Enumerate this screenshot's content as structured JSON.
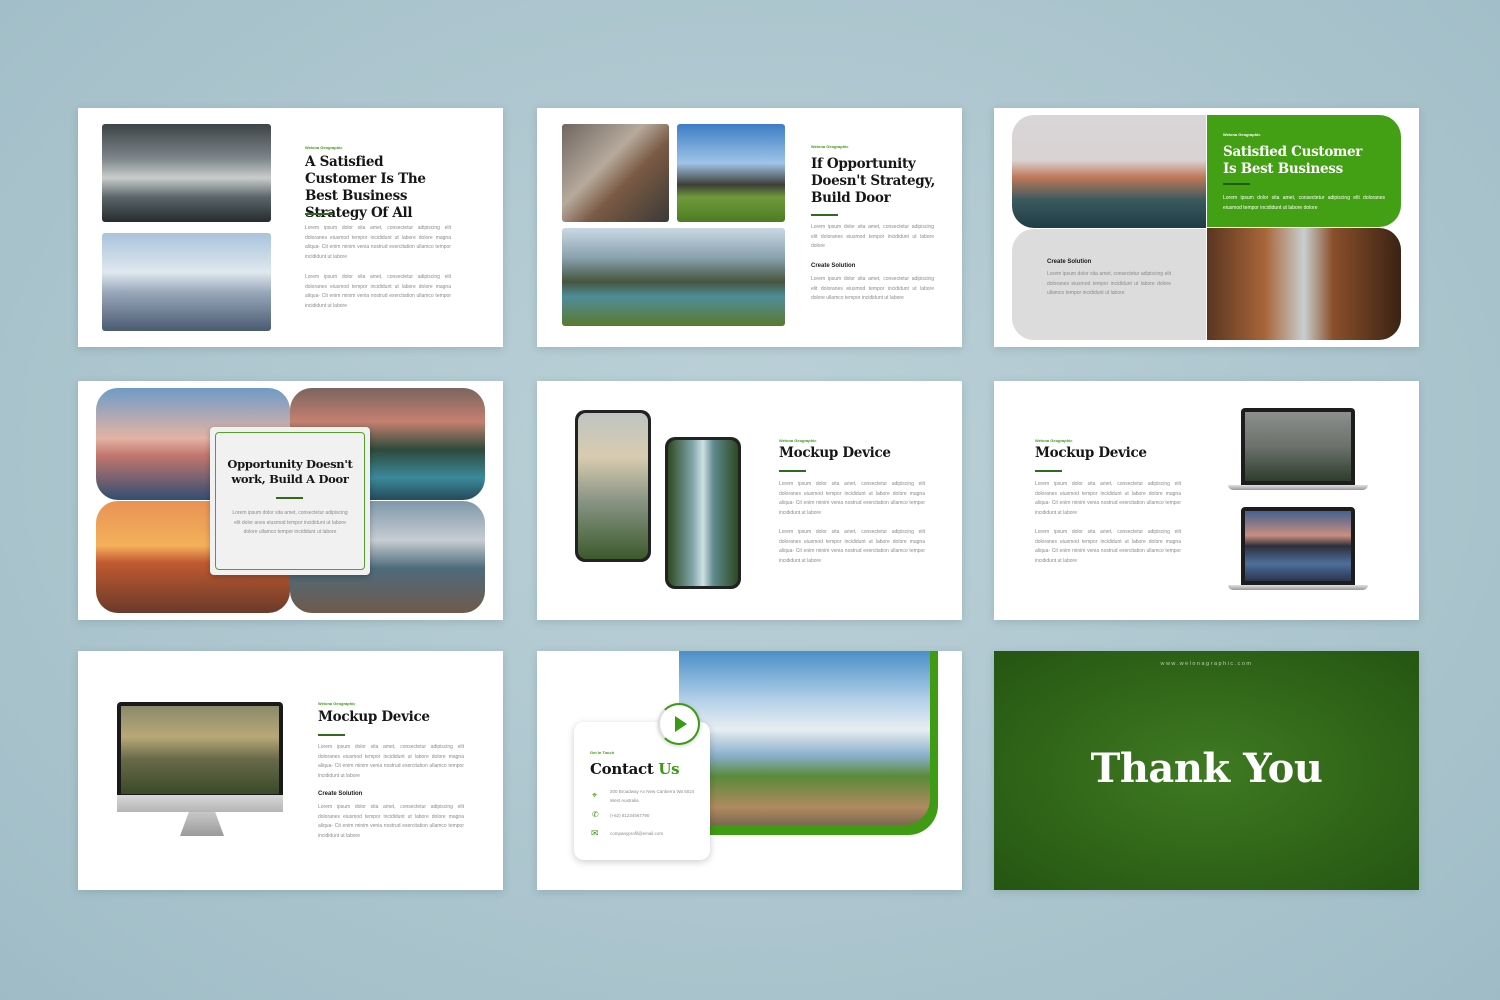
{
  "brand": "Welona Geographic",
  "lorem_long": "Lorem ipsum dolor sita amet, consectetur adipiscing elit doloranes eiusmod tempor incididunt ut labore dolore magna aliqua- Cit enim minim venia nostrud exercitation ullamco tempor incididunt ut labore",
  "lorem_short": "Lorem ipsum dolor sita amet, consectetur adipiscing elit doloranes eiusmod tempor incididunt ut labore dolore",
  "lorem_medium": "Lorem ipsum dolor sita amet, consectetur adipiscing elit doloranes eiusmod tempor incididunt ut labore dolore ullamco tempor incididunt ut labore",
  "lorem_green": "Lorem ipsum dolor sita amet, consectetur adipiscing elit doloranes eiusmod tempor incididunt ut labore dolore",
  "create_solution": "Create Solution",
  "slides": {
    "s1": {
      "title": "A Satisfied Customer Is The Best Business Strategy Of All"
    },
    "s2": {
      "title": "If Opportunity Doesn't Strategy, Build Door"
    },
    "s3": {
      "title": "Satisfied Customer Is Best Business"
    },
    "s4": {
      "title": "Opportunity Doesn't work, Build A Door",
      "para": "Lorem ipsum dolor sita amet, consectetur adipiscing elit dolor anes eiusmod tempor incididunt ut labore dolore ullamco tempor incididunt ut labore"
    },
    "s5": {
      "title": "Mockup Device"
    },
    "s6": {
      "title": "Mockup Device"
    },
    "s7": {
      "title": "Mockup Device"
    },
    "s8": {
      "tag": "Get In Touch",
      "title_a": "Contact",
      "title_b": "Us",
      "address": "200 Broadway Av New Canberra Wa 5024 West Australia",
      "phone": "(+62) 81234567790",
      "email": "companyprofil@email.com"
    },
    "s9": {
      "url": "www.welonagraphic.com",
      "title": "Thank You"
    }
  },
  "colors": {
    "accent": "#3a9a13",
    "dark_green": "#2f6b1d",
    "background": "#aac4cd"
  }
}
